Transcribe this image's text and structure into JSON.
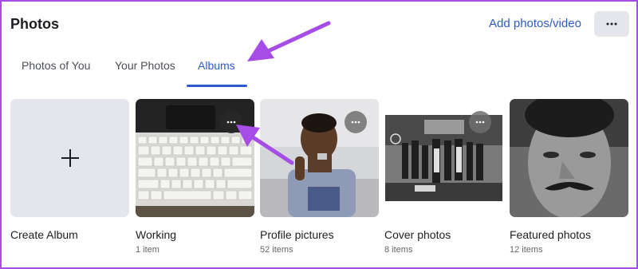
{
  "header": {
    "title": "Photos",
    "add_label": "Add photos/video",
    "more_icon": "ellipsis-icon"
  },
  "tabs": [
    {
      "label": "Photos of You",
      "active": false
    },
    {
      "label": "Your Photos",
      "active": false
    },
    {
      "label": "Albums",
      "active": true
    }
  ],
  "albums": [
    {
      "name": "Create Album",
      "count": ""
    },
    {
      "name": "Working",
      "count": "1 item"
    },
    {
      "name": "Profile pictures",
      "count": "52 items"
    },
    {
      "name": "Cover photos",
      "count": "8 items"
    },
    {
      "name": "Featured photos",
      "count": "12 items"
    }
  ],
  "colors": {
    "accent": "#2d5ac9",
    "annotation_arrow": "#a64de8",
    "frame": "#a64de8"
  }
}
